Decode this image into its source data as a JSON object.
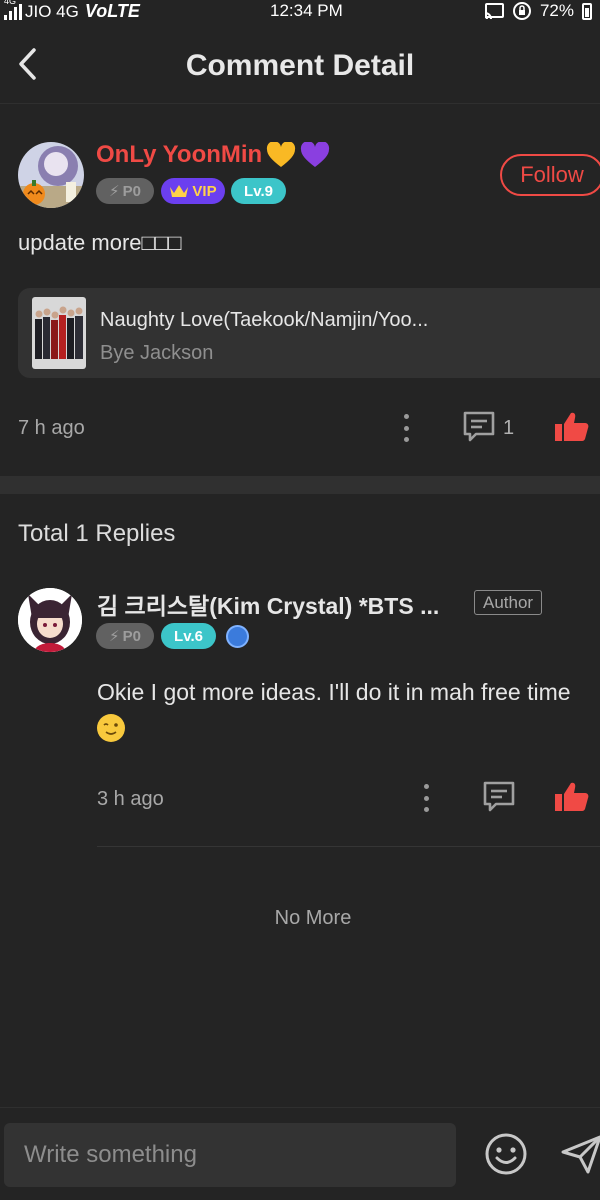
{
  "status_bar": {
    "network_tag": "4G",
    "carrier": "JIO 4G",
    "volte": "VoLTE",
    "time": "12:34 PM",
    "battery": "72%"
  },
  "header": {
    "title": "Comment Detail"
  },
  "post": {
    "username": "OnLy YoonMin",
    "badges": {
      "p0": "P0",
      "vip": "VIP",
      "level": "Lv.9"
    },
    "follow_label": "Follow",
    "text": "update more□□□",
    "book": {
      "title": "Naughty Love(Taekook/Namjin/Yoo...",
      "author": "Bye Jackson"
    },
    "time": "7 h ago",
    "reply_count": "1"
  },
  "replies": {
    "heading": "Total 1 Replies",
    "items": [
      {
        "name": "김 크리스탈(Kim Crystal) *BTS ...",
        "author_tag": "Author",
        "badges": {
          "p0": "P0",
          "level": "Lv.6"
        },
        "text": "Okie I got more ideas. I'll do it in mah free time",
        "time": "3 h ago"
      }
    ],
    "end_text": "No More"
  },
  "composer": {
    "placeholder": "Write something"
  },
  "colors": {
    "accent": "#f04a45",
    "vip": "#6b3ff0",
    "level": "#3cc5c9",
    "background": "#242424"
  }
}
